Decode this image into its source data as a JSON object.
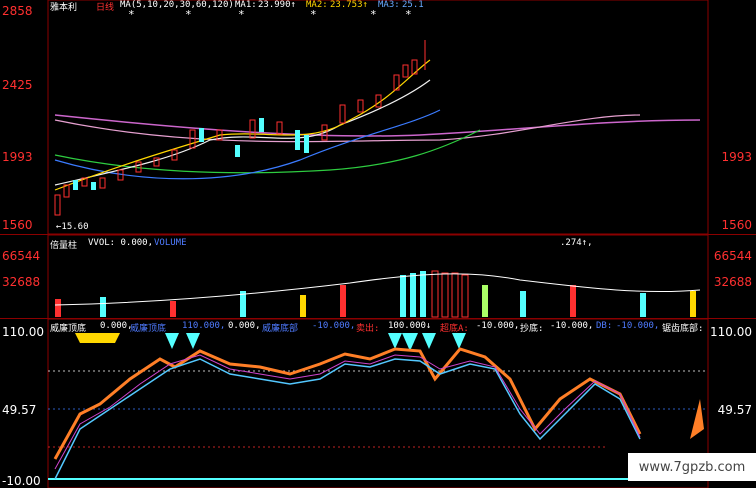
{
  "top_panel": {
    "stock_name": "雅本利",
    "period": "日线",
    "ma_label": "MA(5,10,20,30,60,120)",
    "ma1_label": "MA1:",
    "ma1_value": "23.990↑",
    "ma2_label": "MA2:",
    "ma2_value": "23.753↑",
    "ma3_label": "MA3:",
    "ma3_value": "25.1",
    "left_ticks": [
      "2858",
      "2425",
      "1993",
      "1560"
    ],
    "right_ticks": [
      "1993",
      "1560"
    ],
    "low_marker": "←15.60"
  },
  "volume_panel": {
    "title": "倍量柱",
    "vvol_label": "VVOL: 0.000,",
    "volume_label": "VOLUME",
    "volume_value": ".274↑,",
    "left_ticks": [
      "66544",
      "32688"
    ],
    "right_ticks": [
      "66544",
      "32688"
    ]
  },
  "indicator_panel": {
    "name": "威廉顶底",
    "v0": "0.000,",
    "label1": "威廉顶底",
    "v1": "110.000,",
    "v2": "0.000,",
    "label2": "威廉底部",
    "v3": "-10.000,",
    "sell_label": "卖出:",
    "sell_value": "100.000↓",
    "dip_label": "超底A:",
    "dip_value": "-10.000,",
    "bottom_label": "抄底:",
    "bottom_value": "-10.000,",
    "db_label": "DB:",
    "db_value": "-10.000,",
    "saw_label": "锯齿底部:",
    "left_ticks": [
      "110.00",
      "49.57",
      "-10.00"
    ],
    "right_ticks": [
      "110.00",
      "49.57"
    ]
  },
  "watermark": "www.7gpzb.com",
  "colors": {
    "up": "#ff3030",
    "down": "#54ffff",
    "orange": "#ff7f27",
    "grid": "#8b0000"
  }
}
